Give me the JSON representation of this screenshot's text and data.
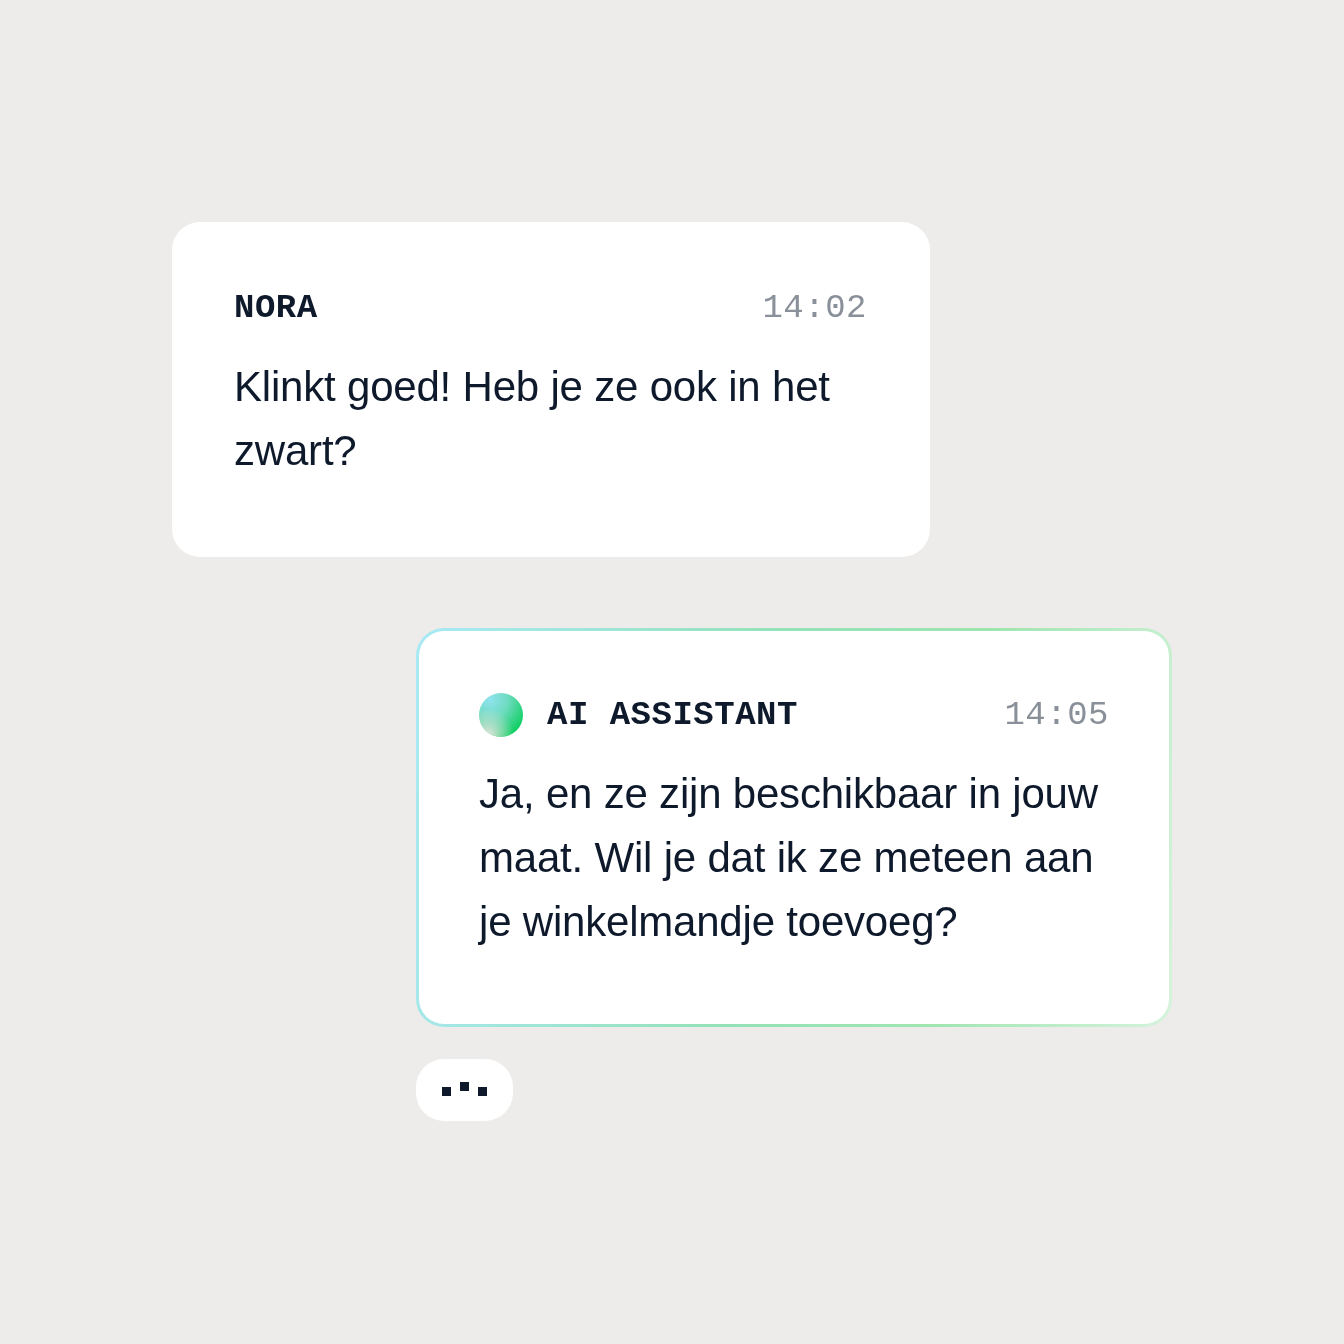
{
  "messages": [
    {
      "kind": "user",
      "sender": "NORA",
      "time": "14:02",
      "text": "Klinkt goed! Heb je ze ook in het zwart?"
    },
    {
      "kind": "assistant",
      "sender": "AI ASSISTANT",
      "time": "14:05",
      "text": "Ja, en ze zijn beschikbaar in jouw maat. Wil je dat ik ze meteen aan je winkelmandje toevoeg?"
    }
  ],
  "typing": true
}
